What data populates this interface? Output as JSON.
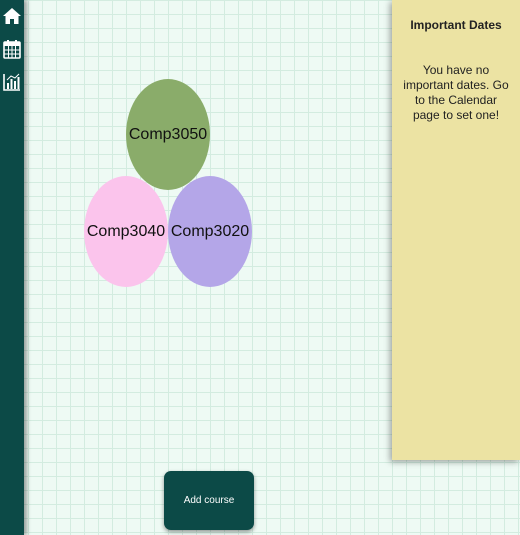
{
  "sidebar": {
    "items": [
      {
        "icon": "home-icon"
      },
      {
        "icon": "calendar-icon"
      },
      {
        "icon": "bar-chart-icon"
      }
    ]
  },
  "courses": [
    {
      "name": "Comp3050",
      "color": "#8aac6a"
    },
    {
      "name": "Comp3040",
      "color": "#fbc4ec"
    },
    {
      "name": "Comp3020",
      "color": "#b4a6e8"
    }
  ],
  "important_dates": {
    "title": "Important Dates",
    "message": "You have no important dates. Go to the Calendar page to set one!"
  },
  "add_course_label": "Add course",
  "colors": {
    "sidebar": "#0c4a47",
    "background": "#eefaf4",
    "panel": "#ece3a3",
    "button": "#0c4a47"
  }
}
